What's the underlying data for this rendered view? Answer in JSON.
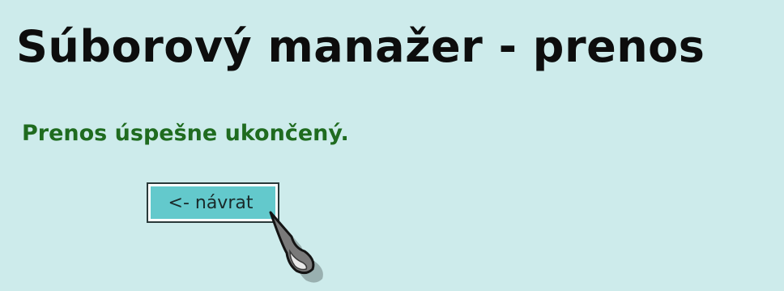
{
  "page": {
    "title": "Súborový manažer - prenos",
    "status_message": "Prenos úspešne ukončený."
  },
  "actions": {
    "back_label": "<- návrat"
  },
  "colors": {
    "background": "#cdebeb",
    "title": "#0d0d0d",
    "status_success": "#1f6b1f",
    "button_fill": "#63c9cc"
  },
  "icons": {
    "cursor": "pointer-cursor-icon"
  }
}
